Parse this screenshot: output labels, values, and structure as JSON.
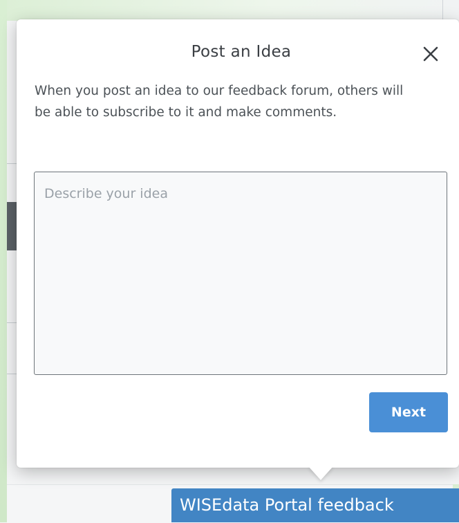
{
  "dialog": {
    "title": "Post an Idea",
    "close_icon": "close-icon",
    "description": "When you post an idea to our feedback forum, others will be able to subscribe to it and make comments.",
    "idea_input": {
      "placeholder": "Describe your idea",
      "value": ""
    },
    "next_label": "Next"
  },
  "feedback_tab": {
    "label": "WISEdata Portal feedback"
  },
  "colors": {
    "accent": "#4a8fd6",
    "tab": "#4285c4",
    "title_text": "#3b3f44",
    "body_text": "#4c5257"
  }
}
